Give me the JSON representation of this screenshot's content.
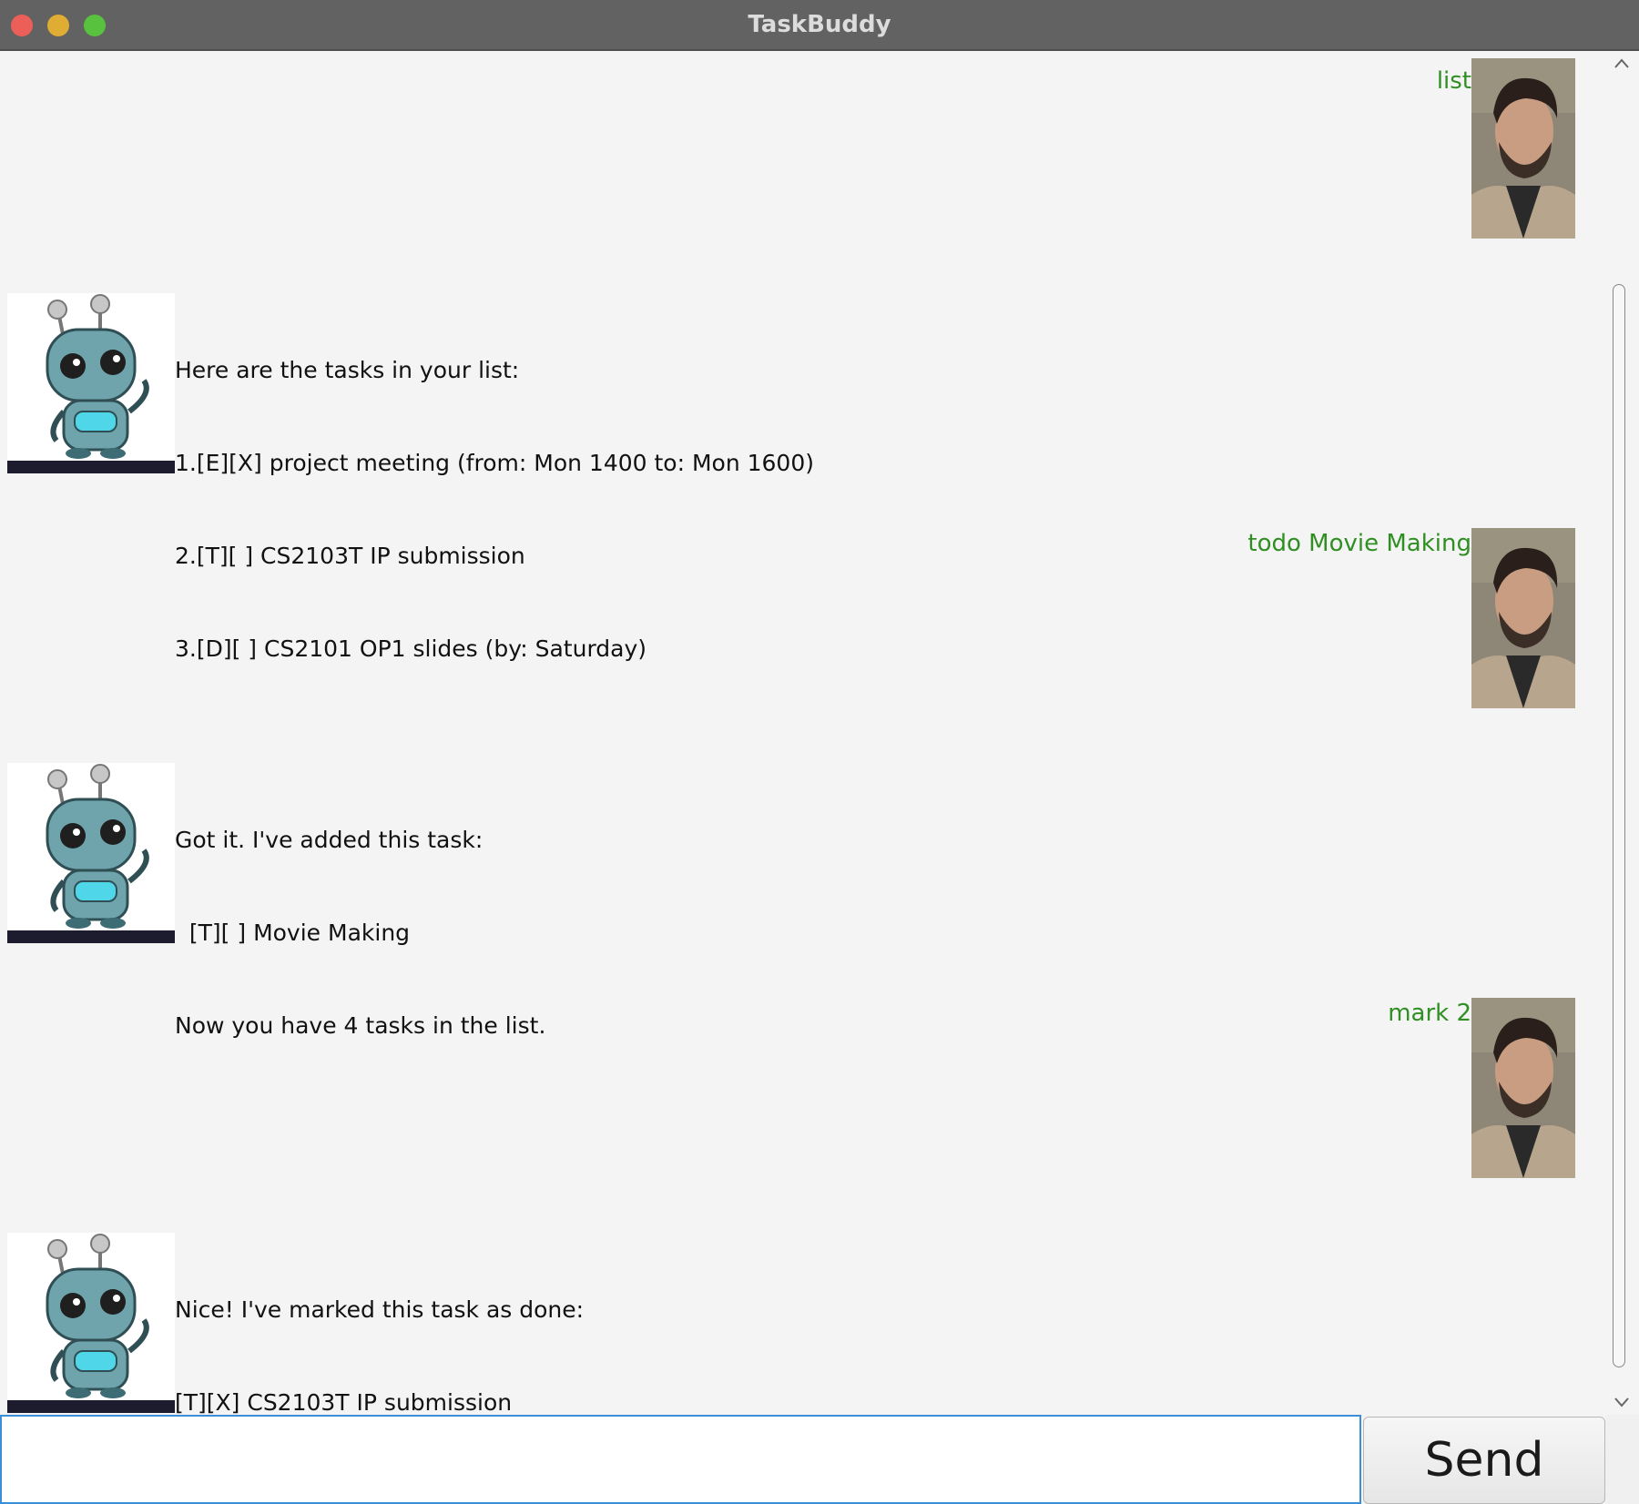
{
  "window": {
    "title": "TaskBuddy"
  },
  "messages": [
    {
      "sender": "user",
      "text": "list"
    },
    {
      "sender": "bot",
      "lines": [
        "Here are the tasks in your list:",
        "1.[E][X] project meeting (from: Mon 1400 to: Mon 1600)",
        "2.[T][ ] CS2103T IP submission",
        "3.[D][ ] CS2101 OP1 slides (by: Saturday)"
      ]
    },
    {
      "sender": "user",
      "text": "todo Movie Making"
    },
    {
      "sender": "bot",
      "lines": [
        "Got it. I've added this task:",
        "  [T][ ] Movie Making",
        "Now you have 4 tasks in the list."
      ]
    },
    {
      "sender": "user",
      "text": "mark 2"
    },
    {
      "sender": "bot",
      "lines": [
        "Nice! I've marked this task as done:",
        "[T][X] CS2103T IP submission"
      ]
    }
  ],
  "input": {
    "value": "",
    "placeholder": ""
  },
  "send_button": {
    "label": "Send"
  },
  "icons": {
    "user_avatar": "man-photo-avatar",
    "bot_avatar": "robot-avatar"
  },
  "colors": {
    "user_text": "#2f8f22",
    "title_bar": "#616261",
    "input_border": "#3a8fd8"
  }
}
